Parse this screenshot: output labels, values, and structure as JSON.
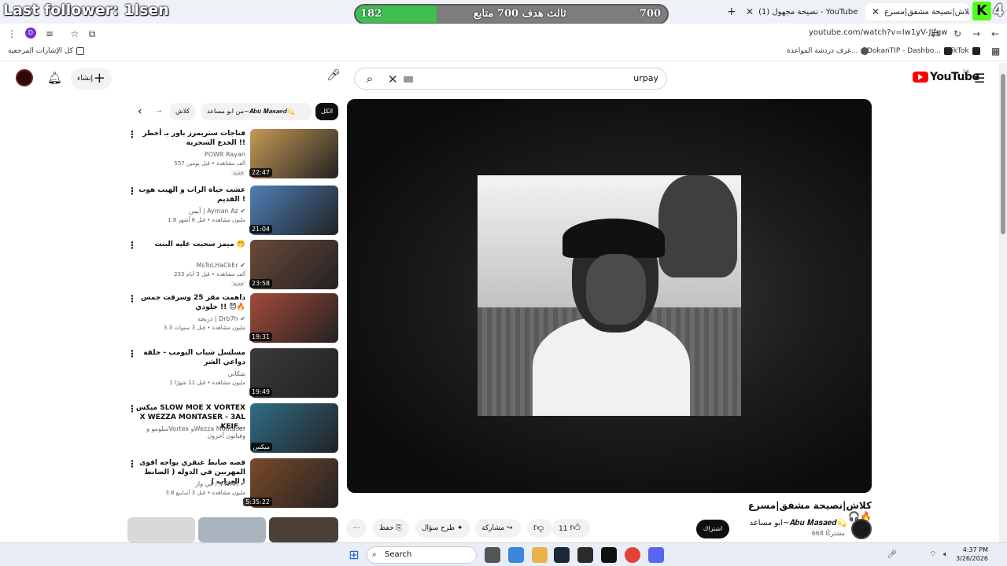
{
  "overlay": {
    "follower_text": "Last follower: 1lsen",
    "goal_label": "ثالث هدف 700 متابع",
    "goal_current": "182",
    "goal_target": "700",
    "goal_fraction": 0.26,
    "kick_letter": "K",
    "kick_count": "4"
  },
  "tabs": [
    {
      "title": "كلاش|نصيحة مشفق|مسرع",
      "active": true
    },
    {
      "title": "(1) نصيحة مجهول - YouTube",
      "active": false
    }
  ],
  "address": {
    "url": "youtube.com/watch?v=Iw1yV-JJfgw",
    "profile_letter": "D"
  },
  "bookmarks": {
    "all": "كل الإشارات المرجعية",
    "items": [
      "غرف دردشة المواعدة...",
      "DokanTIP - Dashbo...",
      "TikTok"
    ]
  },
  "masthead": {
    "search_value": "urpay",
    "create_label": "إنشاء",
    "logo_text": "YouTube",
    "region": "SA"
  },
  "chips": {
    "all": "الكل",
    "from_channel": "من ابو مساعد~𝑨𝒃𝒖 𝑴𝒂𝒔𝒂𝒆𝒅💫",
    "related": "كلاش"
  },
  "video": {
    "title": "كلاش|نصيحة مشفق|مسرع 🎧🔥",
    "channel": "ابو مساعد~𝑨𝒃𝒖 𝑴𝒂𝒔𝒂𝒆𝒅💫",
    "subscribers": "668 مشتركًا",
    "subscribe_label": "اشتراك",
    "likes": "11",
    "share_label": "مشاركة",
    "ask_label": "طرح سؤال",
    "save_label": "حفظ"
  },
  "recommendations": [
    {
      "title": "فناجات ستريمرز باور بـ أخطر الخدع السحرية !!",
      "channel": "POWR Rayan",
      "meta": "557 ألف مشاهدة • قبل يومين",
      "badge": "جديد",
      "duration": "22:47",
      "color": "#c79a55"
    },
    {
      "title": "عشت حياة الراب و الهيب هوب القديم !",
      "channel": "أيمن | Ayman Az ✔",
      "meta": "1.8 مليون مشاهدة • قبل 6 أشهر",
      "badge": "",
      "duration": "21:04",
      "color": "#4e7fb8"
    },
    {
      "title": "ميمز سحبت  عليه البنت 🤭",
      "channel": "MsToLHaCkEr ✔",
      "meta": "233 ألف مشاهدة • قبل 3 أيام",
      "badge": "جديد",
      "duration": "23:58",
      "color": "#6b4a3a"
    },
    {
      "title": "داهمت مقر 25 وسرقت جمس خلودي !! 😈🔥",
      "channel": "دريحه | Drb7h ✔",
      "meta": "3.3 مليون مشاهدة • قبل 3 سنوات",
      "badge": "",
      "duration": "19:31",
      "color": "#a44a3a"
    },
    {
      "title": "مسلسل شباب البومب - حلقة دواعي الشر",
      "channel": "شكاتي",
      "meta": "1 مليون مشاهدة • قبل 11 شهرًا",
      "badge": "",
      "duration": "19:49",
      "color": "#3a3a3a"
    },
    {
      "title": "ميكس SLOW MOE X VORTEX X WEZZA MONTASER - 3AL KEIF...",
      "channel": "سلومو وVortex وWezza Montaser وفنانون آخرون",
      "meta": "",
      "badge": "",
      "duration": "ميكس",
      "color": "#2f6e86"
    },
    {
      "title": "قصه ضابط عبقري يواجه اقوى المهربين في الدوله ( الضابط العراب ) !",
      "channel": "في وار / VWAR ✔",
      "meta": "3.8 مليون مشاهدة • قبل 3 أسابيع",
      "badge": "",
      "duration": "5:35:22",
      "color": "#7a4a2a"
    }
  ],
  "taskbar": {
    "search_label": "Search",
    "time": "4:37 PM",
    "date": "3/26/2026"
  }
}
